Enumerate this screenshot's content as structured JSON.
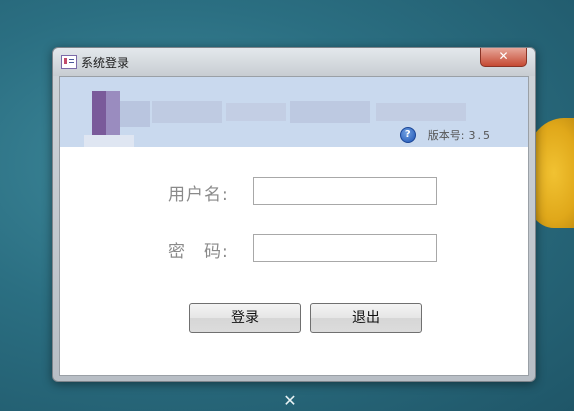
{
  "window": {
    "title": "系统登录",
    "close_glyph": "✕"
  },
  "banner": {
    "help_glyph": "?",
    "version_label": "版本号:",
    "version_value": "3.5"
  },
  "form": {
    "username_label": "用户名:",
    "username_value": "",
    "password_label": "密　码:",
    "password_value": ""
  },
  "buttons": {
    "login_label": "登录",
    "exit_label": "退出"
  },
  "colors": {
    "banner_bg": "#c9d9ee",
    "close_button": "#c54a33",
    "desktop": "#2b6f82"
  }
}
